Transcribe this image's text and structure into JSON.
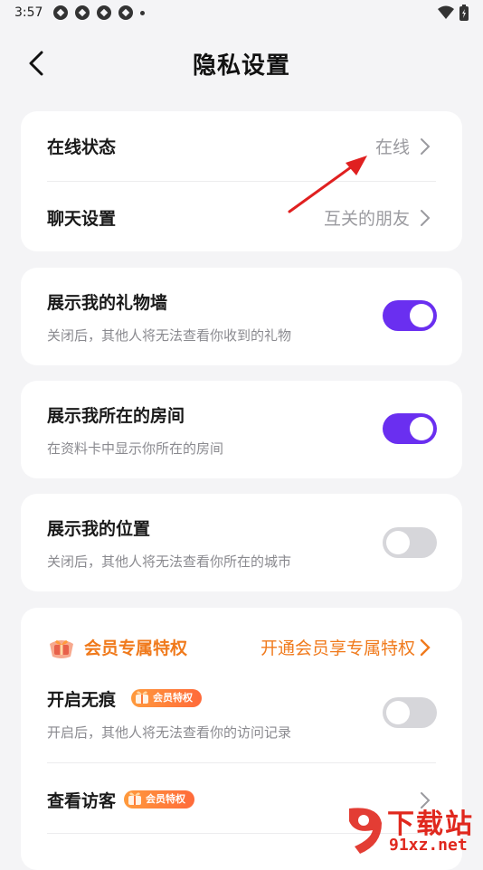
{
  "status_bar": {
    "time": "3:57"
  },
  "header": {
    "title": "隐私设置"
  },
  "card1": {
    "online_label": "在线状态",
    "online_value": "在线",
    "chat_label": "聊天设置",
    "chat_value": "互关的朋友"
  },
  "gift_wall": {
    "label": "展示我的礼物墙",
    "desc": "关闭后，其他人将无法查看你收到的礼物",
    "enabled": true
  },
  "room": {
    "label": "展示我所在的房间",
    "desc": "在资料卡中显示你所在的房间",
    "enabled": true
  },
  "location": {
    "label": "展示我的位置",
    "desc": "关闭后，其他人将无法查看你所在的城市",
    "enabled": false
  },
  "vip": {
    "title": "会员专属特权",
    "link": "开通会员享专属特权",
    "badge": "会员特权",
    "incognito_label": "开启无痕",
    "incognito_desc": "开启后，其他人将无法查看你的访问记录",
    "incognito_enabled": false,
    "visitors_label": "查看访客"
  },
  "watermark": {
    "text1": "下载站",
    "text2": "91xz.net"
  },
  "colors": {
    "accent": "#6a2ff0",
    "vip": "#f07a1c",
    "arrow": "#e02020"
  }
}
